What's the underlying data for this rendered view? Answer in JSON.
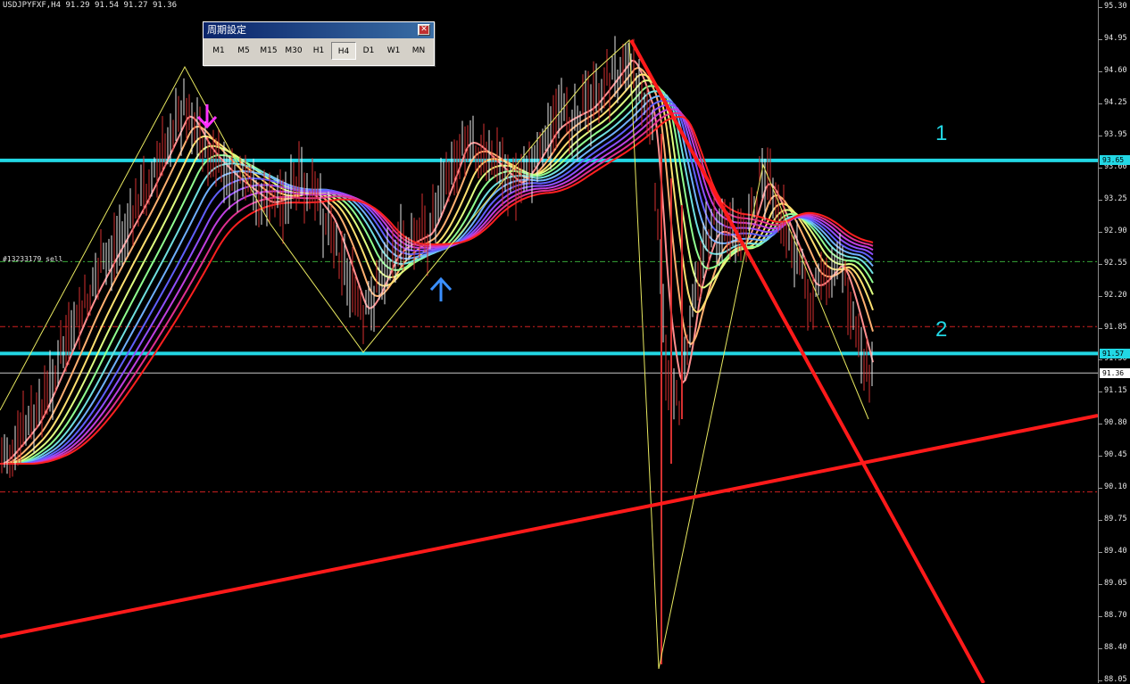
{
  "chart_window": {
    "symbol_info": "USDJPYFXF,H4  91.29 91.54 91.27 91.36",
    "order_label": "#13233179 sell",
    "level_labels": [
      "1",
      "2"
    ],
    "y_axis": {
      "min": 88.05,
      "max": 95.3,
      "ticks": [
        "95.30",
        "94.95",
        "94.60",
        "94.25",
        "93.95",
        "93.60",
        "93.25",
        "92.90",
        "92.55",
        "92.20",
        "91.85",
        "91.50",
        "91.15",
        "90.80",
        "90.45",
        "90.10",
        "89.75",
        "89.40",
        "89.05",
        "88.70",
        "88.40",
        "88.05"
      ]
    },
    "price_markers": [
      {
        "value": "93.65",
        "price": 93.65,
        "bg": "#22d7e4",
        "fg": "#000000"
      },
      {
        "value": "91.57",
        "price": 91.57,
        "bg": "#22d7e4",
        "fg": "#000000"
      },
      {
        "value": "91.36",
        "price": 91.36,
        "bg": "#ffffff",
        "fg": "#000000"
      }
    ],
    "horizontal_lines": [
      {
        "price": 93.65,
        "color": "#22d7e4",
        "style": "solid",
        "width": 4
      },
      {
        "price": 91.57,
        "color": "#22d7e4",
        "style": "solid",
        "width": 4
      },
      {
        "price": 91.36,
        "color": "#c8c8c8",
        "style": "solid",
        "width": 1
      },
      {
        "price": 92.56,
        "color": "#38a838",
        "style": "dashdot",
        "width": 1
      },
      {
        "price": 91.86,
        "color": "#d02020",
        "style": "dashdot",
        "width": 1
      },
      {
        "price": 90.08,
        "color": "#d02020",
        "style": "dashdot",
        "width": 1
      }
    ],
    "colors": {
      "background": "#000000",
      "trendline": "#ff1a1a",
      "zigzag": "#e8e860",
      "level_line": "#22d7e4",
      "arrow_down": "#ff30ff",
      "arrow_up": "#3a8fff"
    }
  },
  "period_dialog": {
    "title": "周期設定",
    "buttons": [
      {
        "label": "M1",
        "active": false
      },
      {
        "label": "M5",
        "active": false
      },
      {
        "label": "M15",
        "active": false
      },
      {
        "label": "M30",
        "active": false
      },
      {
        "label": "H1",
        "active": false
      },
      {
        "label": "H4",
        "active": true
      },
      {
        "label": "D1",
        "active": false
      },
      {
        "label": "W1",
        "active": false
      },
      {
        "label": "MN",
        "active": false
      }
    ]
  }
}
